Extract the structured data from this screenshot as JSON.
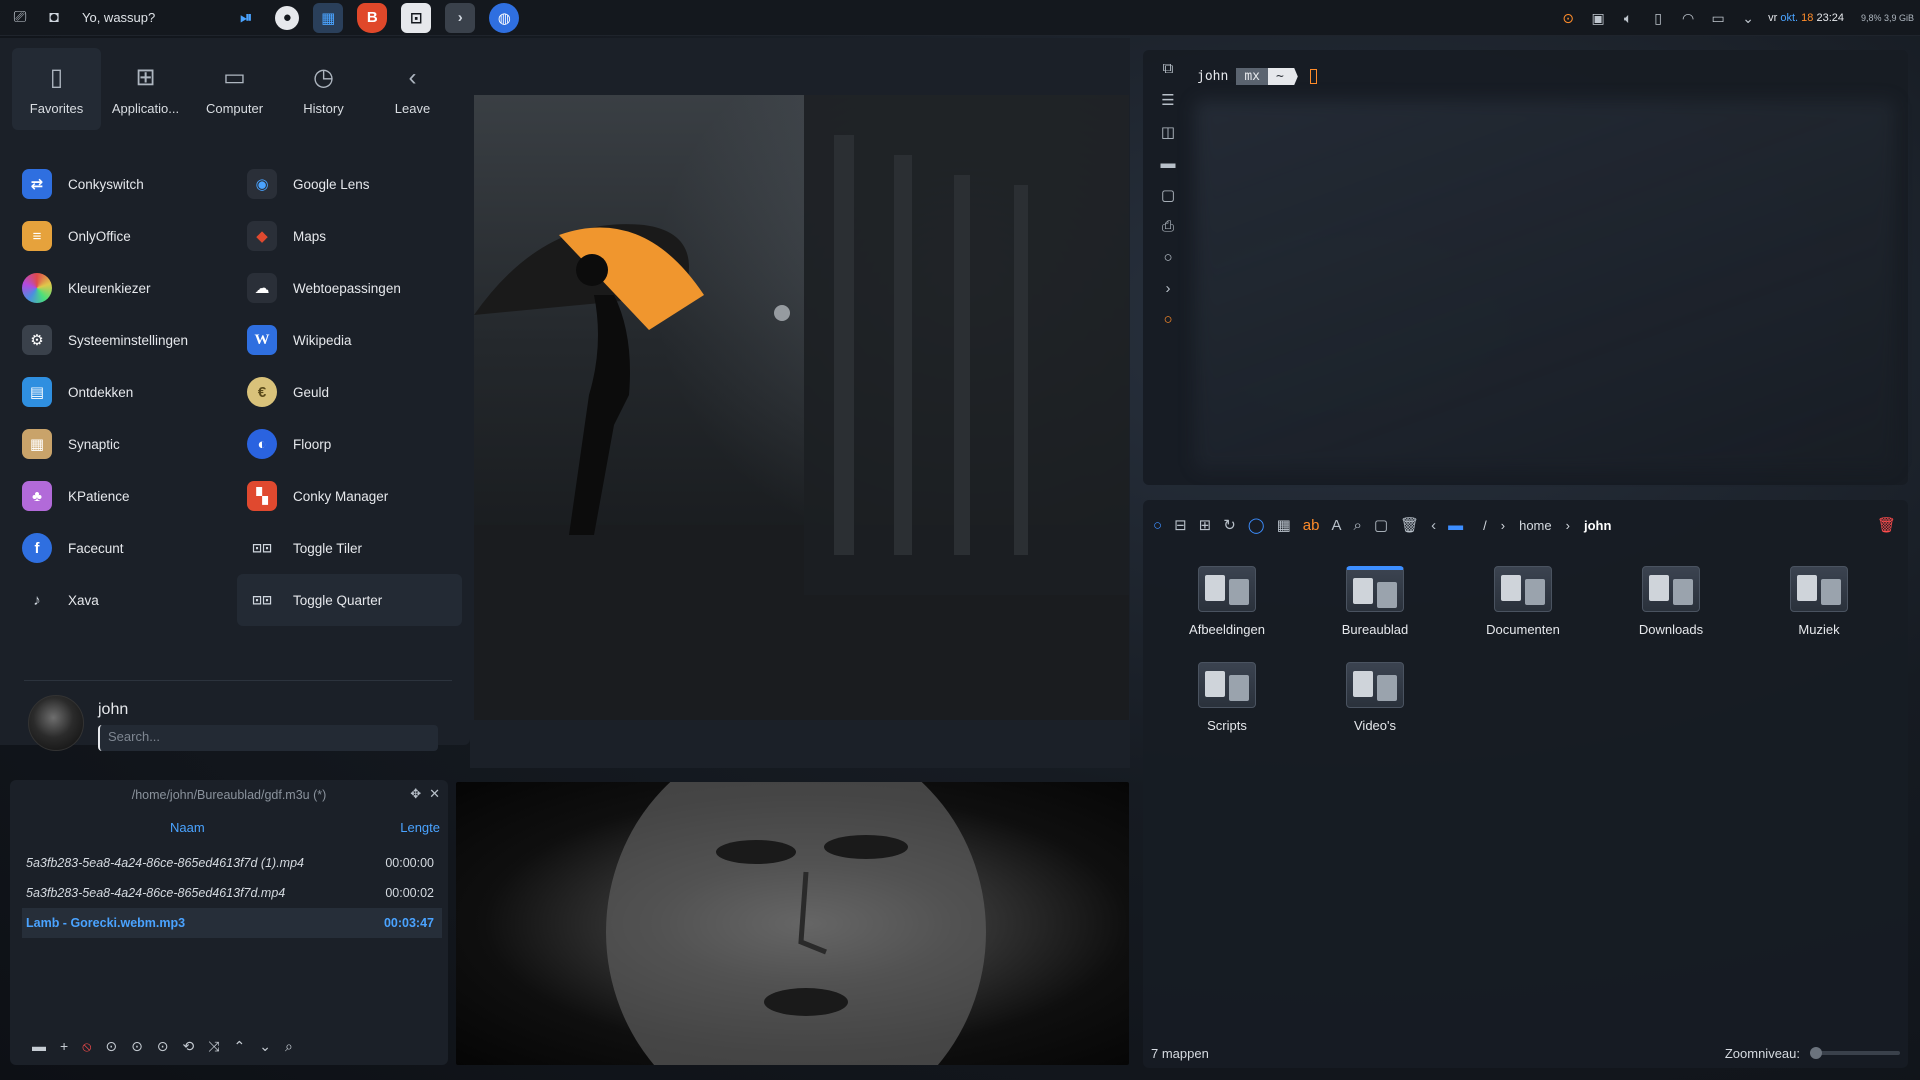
{
  "top_panel": {
    "greeting": "Yo, wassup?",
    "memory": "9,8% 3,9 GiB",
    "clock": {
      "day": "vr",
      "month": "okt.",
      "date": "18",
      "time": "23:24"
    },
    "icons": [
      "application-dashboard-icon",
      "screenshot-icon",
      "media-play-pause-icon",
      "music-player-icon",
      "file-manager-icon",
      "brave-browser-icon",
      "terminal-icon",
      "console-icon",
      "globe-icon"
    ],
    "tray": [
      "update-icon",
      "clipboard-icon",
      "volume-icon",
      "phone-icon",
      "network-icon",
      "battery-icon",
      "expand-icon"
    ]
  },
  "launcher": {
    "tabs": [
      {
        "label": "Favorites",
        "icon": "bookmark-icon"
      },
      {
        "label": "Applicatio...",
        "icon": "grid-icon"
      },
      {
        "label": "Computer",
        "icon": "monitor-icon"
      },
      {
        "label": "History",
        "icon": "clock-icon"
      },
      {
        "label": "Leave",
        "icon": "back-icon"
      }
    ],
    "apps": [
      {
        "label": "Conkyswitch",
        "color": "#2f6fe0"
      },
      {
        "label": "Google Lens",
        "color": "#2a2f38"
      },
      {
        "label": "OnlyOffice",
        "color": "#e6a23c"
      },
      {
        "label": "Maps",
        "color": "#2a2f38"
      },
      {
        "label": "Kleurenkiezer",
        "color": "#e04a8b"
      },
      {
        "label": "Webtoepassingen",
        "color": "#2a2f38"
      },
      {
        "label": "Systeeminstellingen",
        "color": "#3a414b"
      },
      {
        "label": "Wikipedia",
        "color": "#2f6fe0"
      },
      {
        "label": "Ontdekken",
        "color": "#2f8fe0"
      },
      {
        "label": "Geuld",
        "color": "#d9c27a"
      },
      {
        "label": "Synaptic",
        "color": "#c9a36a"
      },
      {
        "label": "Floorp",
        "color": "#2a63e0"
      },
      {
        "label": "KPatience",
        "color": "#b26ad9"
      },
      {
        "label": "Conky Manager",
        "color": "#e0492f"
      },
      {
        "label": "Facecunt",
        "color": "#2f6fe0"
      },
      {
        "label": "Toggle Tiler",
        "color": "#2a2f38"
      },
      {
        "label": "Xava",
        "color": "#2a2f38"
      },
      {
        "label": "Toggle Quarter",
        "color": "#2a2f38"
      }
    ],
    "user": "john",
    "search_placeholder": "Search..."
  },
  "terminal": {
    "user": "john",
    "host": "mx",
    "dir": "~",
    "side_icons": [
      "new-tab-icon",
      "list-icon",
      "split-icon",
      "folder-icon",
      "window-icon",
      "print-icon",
      "circle-icon",
      "chevron-right-icon",
      "record-icon"
    ]
  },
  "file_manager": {
    "path_root": "/",
    "path": [
      "home",
      "john"
    ],
    "folders": [
      "Afbeeldingen",
      "Bureaublad",
      "Documenten",
      "Downloads",
      "Muziek",
      "Scripts",
      "Video's"
    ],
    "status": "7 mappen",
    "zoom_label": "Zoomniveau:",
    "zoom_level": 0.0
  },
  "playlist": {
    "path": "/home/john/Bureaublad/gdf.m3u (*)",
    "col_name": "Naam",
    "col_length": "Lengte",
    "rows": [
      {
        "title": "5a3fb283-5ea8-4a24-86ce-865ed4613f7d (1).mp4",
        "length": "00:00:00"
      },
      {
        "title": "5a3fb283-5ea8-4a24-86ce-865ed4613f7d.mp4",
        "length": "00:00:02"
      },
      {
        "title": "Lamb - Gorecki.webm.mp3",
        "length": "00:03:47"
      }
    ]
  }
}
